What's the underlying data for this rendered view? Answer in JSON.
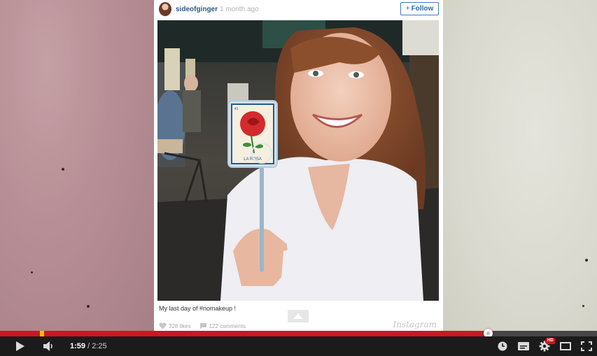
{
  "post": {
    "username": "sideofginger",
    "time_sep": "·",
    "time": "1 month ago",
    "follow_plus": "+",
    "follow_label": "Follow",
    "caption": "My last day of #nomakeup !",
    "likes": "328 likes",
    "comments": "122 comments",
    "brand": "Instagram",
    "photo_card_label": "LA ROSA",
    "photo_card_number": "41"
  },
  "player": {
    "current_time": "1:59",
    "time_sep": " / ",
    "duration": "2:25",
    "progress_fraction": 0.817,
    "hd_badge": "HD"
  },
  "icons": {
    "play": "play-icon",
    "volume": "volume-icon",
    "watch_later": "clock-icon",
    "captions": "captions-icon",
    "settings": "gear-icon",
    "theater": "theater-mode-icon",
    "fullscreen": "fullscreen-icon"
  },
  "colors": {
    "accent": "#cc181e",
    "marker": "#f4c000",
    "link": "#2f5a85"
  }
}
